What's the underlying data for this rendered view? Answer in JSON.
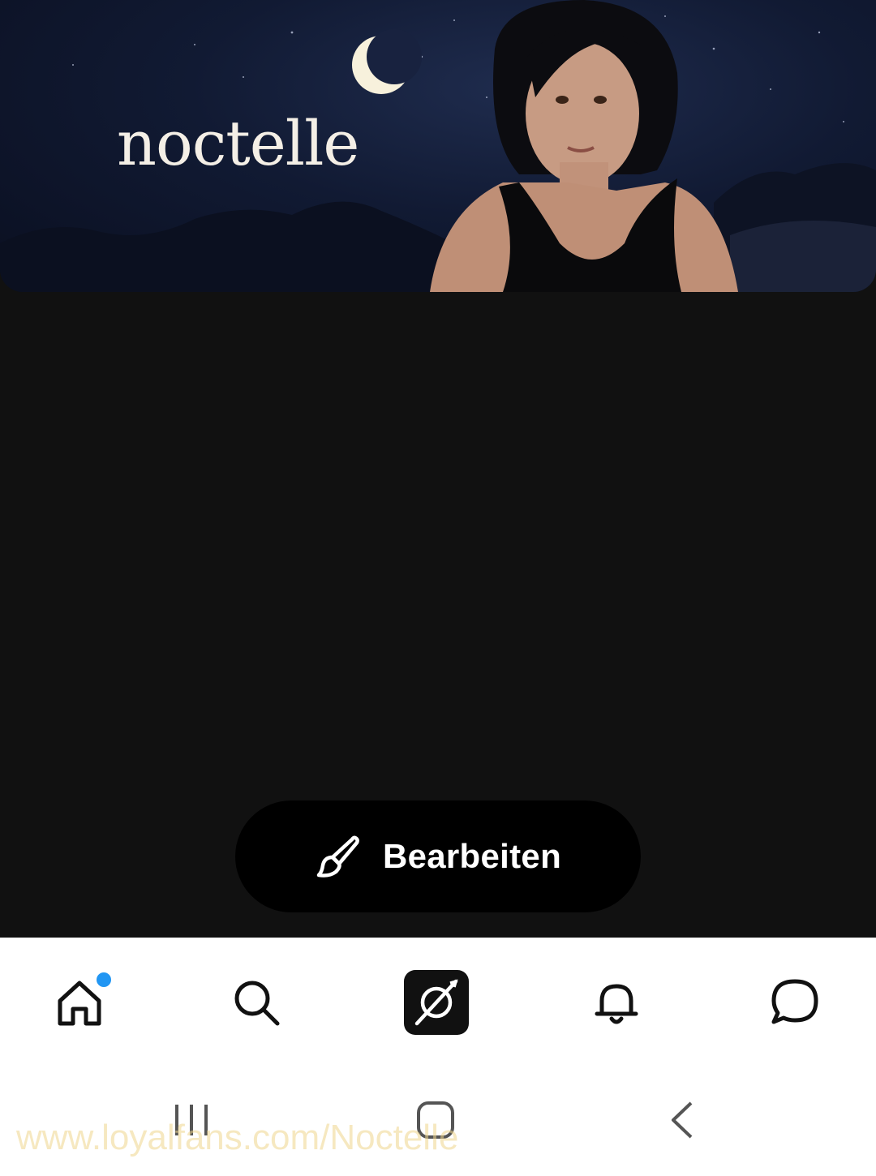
{
  "banner": {
    "brand_text": "noctelle"
  },
  "edit_button": {
    "label": "Bearbeiten",
    "icon": "paintbrush-icon"
  },
  "bottom_nav": {
    "items": [
      {
        "name": "home",
        "icon": "home-icon",
        "active": true,
        "badge": true
      },
      {
        "name": "search",
        "icon": "search-icon"
      },
      {
        "name": "app",
        "icon": "app-logo-icon"
      },
      {
        "name": "notifications",
        "icon": "bell-icon"
      },
      {
        "name": "messages",
        "icon": "chat-bubble-icon"
      }
    ],
    "badge_color": "#2196F3"
  },
  "system_nav": {
    "items": [
      "recents-button",
      "home-button",
      "back-button"
    ]
  },
  "watermark": {
    "text": "www.loyalfans.com/Noctelle"
  },
  "colors": {
    "background": "#111111",
    "button_bg": "#000000",
    "nav_bg": "#ffffff",
    "accent_badge": "#2196F3"
  }
}
